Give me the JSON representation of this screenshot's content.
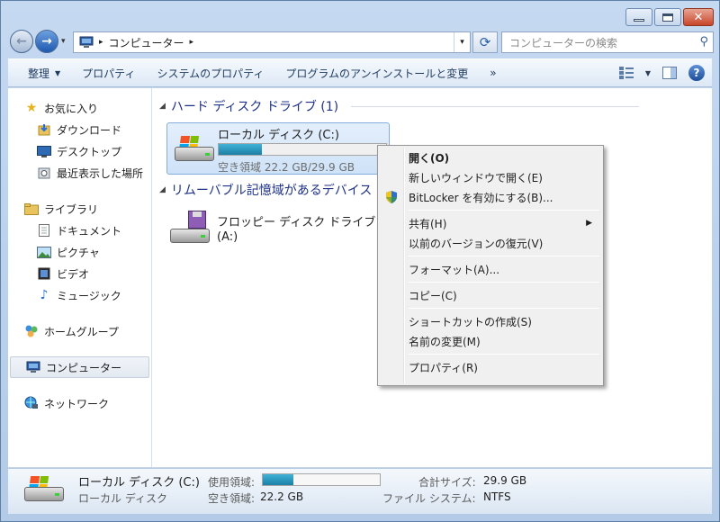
{
  "window": {
    "controls": {
      "minimize_icon": "minimize-icon",
      "maximize_icon": "maximize-icon",
      "close_glyph": "✕"
    }
  },
  "nav": {
    "back_glyph": "←",
    "forward_glyph": "→",
    "history_glyph": "▾",
    "address_parts": [
      "コンピューター"
    ],
    "address_sep": "▸",
    "refresh_glyph": "⟳",
    "search_placeholder": "コンピューターの検索",
    "search_glyph": "⚲"
  },
  "toolbar": {
    "organize": "整理",
    "properties": "プロパティ",
    "system_properties": "システムのプロパティ",
    "uninstall": "プログラムのアンインストールと変更",
    "more": "»",
    "help": "?"
  },
  "sidebar": {
    "favorites": "お気に入り",
    "downloads": "ダウンロード",
    "desktop": "デスクトップ",
    "recent": "最近表示した場所",
    "libraries": "ライブラリ",
    "documents": "ドキュメント",
    "pictures": "ピクチャ",
    "videos": "ビデオ",
    "music": "ミュージック",
    "homegroup": "ホームグループ",
    "computer": "コンピューター",
    "network": "ネットワーク"
  },
  "main": {
    "hdd_header": "ハード ディスク ドライブ (1)",
    "removable_header": "リムーバブル記憶域があるデバイス",
    "drive_c": {
      "name": "ローカル ディスク (C:)",
      "free_text": "空き領域 22.2 GB/29.9 GB",
      "used_fraction": 0.26
    },
    "floppy": {
      "name": "フロッピー ディスク ドライブ",
      "letter": "(A:)"
    }
  },
  "context_menu": {
    "open": "開く(O)",
    "open_new_window": "新しいウィンドウで開く(E)",
    "bitlocker": "BitLocker を有効にする(B)...",
    "share": "共有(H)",
    "restore": "以前のバージョンの復元(V)",
    "format": "フォーマット(A)...",
    "copy": "コピー(C)",
    "create_shortcut": "ショートカットの作成(S)",
    "rename": "名前の変更(M)",
    "properties": "プロパティ(R)"
  },
  "details": {
    "name": "ローカル ディスク (C:)",
    "type": "ローカル ディスク",
    "used_label": "使用領域:",
    "free_label": "空き領域:",
    "free_value": "22.2 GB",
    "total_label": "合計サイズ:",
    "total_value": "29.9 GB",
    "fs_label": "ファイル システム:",
    "fs_value": "NTFS"
  },
  "colors": {
    "accent": "#1e3287",
    "usage_bar": "#1b7fa6",
    "selection": "#cee2f8"
  }
}
